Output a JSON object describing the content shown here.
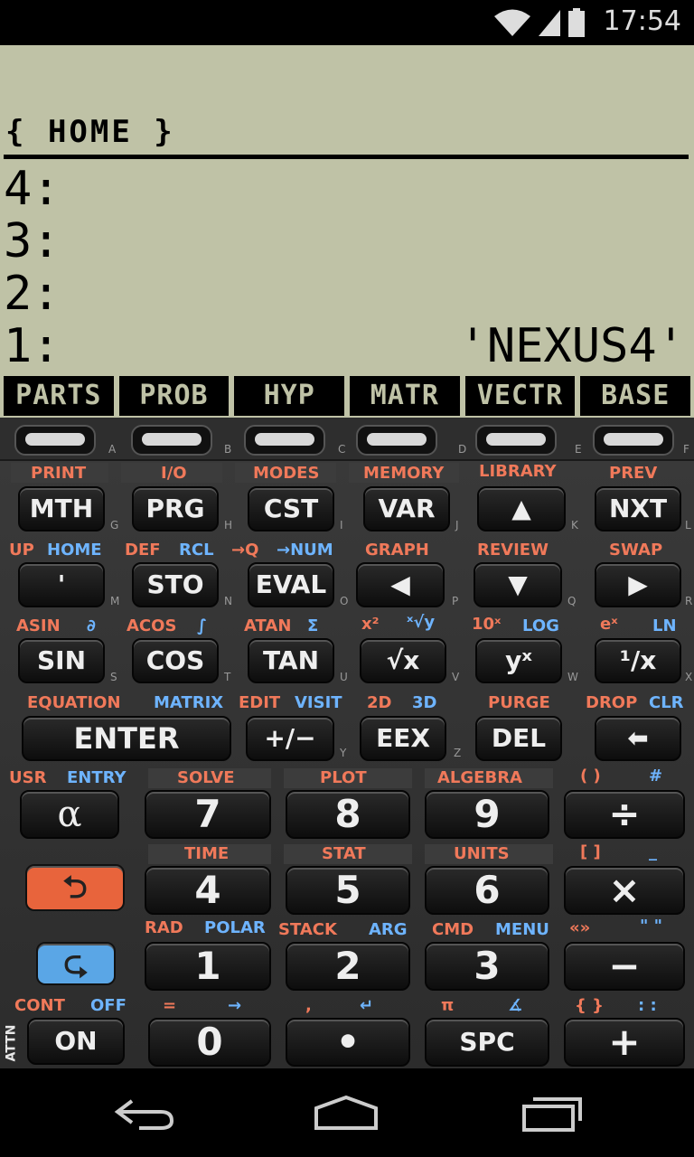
{
  "status_bar": {
    "time": "17:54",
    "icons": [
      "wifi-icon",
      "cell-signal-icon",
      "battery-icon"
    ]
  },
  "lcd": {
    "directory": "{ HOME }",
    "stack": [
      {
        "level": "4:",
        "value": ""
      },
      {
        "level": "3:",
        "value": ""
      },
      {
        "level": "2:",
        "value": ""
      },
      {
        "level": "1:",
        "value": "'NEXUS4'"
      }
    ],
    "menu_keys": [
      "PARTS",
      "PROB",
      "HYP",
      "MATR",
      "VECTR",
      "BASE"
    ]
  },
  "soft_key_letters": [
    "A",
    "B",
    "C",
    "D",
    "E",
    "F"
  ],
  "rows": {
    "r1": {
      "shift": [
        "PRINT",
        "I/O",
        "MODES",
        "MEMORY",
        "LIBRARY",
        "PREV"
      ],
      "keys": [
        "MTH",
        "PRG",
        "CST",
        "VAR",
        "▲",
        "NXT"
      ],
      "alpha": [
        "G",
        "H",
        "I",
        "J",
        "K",
        "L"
      ]
    },
    "r2": {
      "shift_left": [
        "UP",
        "DEF",
        "→Q",
        "GRAPH",
        "REVIEW",
        "SWAP"
      ],
      "shift_right": [
        "HOME",
        "RCL",
        "→NUM"
      ],
      "keys": [
        "'",
        "STO",
        "EVAL",
        "◀",
        "▼",
        "▶"
      ],
      "alpha": [
        "M",
        "N",
        "O",
        "P",
        "Q",
        "R"
      ]
    },
    "r3": {
      "shift_left": [
        "ASIN",
        "ACOS",
        "ATAN",
        "x²",
        "10ˣ",
        "eˣ"
      ],
      "shift_right": [
        "∂",
        "∫",
        "Σ",
        "ˣ√y",
        "LOG",
        "LN"
      ],
      "keys": [
        "SIN",
        "COS",
        "TAN",
        "√x",
        "yˣ",
        "¹/x"
      ],
      "alpha": [
        "S",
        "T",
        "U",
        "V",
        "W",
        "X"
      ]
    },
    "r4": {
      "shift_left": [
        "EQUATION",
        "EDIT",
        "2D",
        "PURGE",
        "DROP"
      ],
      "shift_right": [
        "MATRIX",
        "VISIT",
        "3D",
        "CLR"
      ],
      "keys": [
        "ENTER",
        "+/−",
        "EEX",
        "DEL",
        "⬅"
      ],
      "alpha": [
        "Y",
        "Z"
      ]
    },
    "r5": {
      "shift_left": [
        "USR",
        "SOLVE",
        "PLOT",
        "ALGEBRA",
        "( )"
      ],
      "shift_right": [
        "ENTRY",
        "#"
      ],
      "keys": [
        "α",
        "7",
        "8",
        "9",
        "÷"
      ]
    },
    "r6": {
      "shift_left": [
        "TIME",
        "STAT",
        "UNITS",
        "[ ]"
      ],
      "shift_right": [
        "_"
      ],
      "keys": [
        "⮌",
        "4",
        "5",
        "6",
        "×"
      ]
    },
    "r7": {
      "shift_left": [
        "RAD",
        "STACK",
        "CMD",
        "«»"
      ],
      "shift_right": [
        "POLAR",
        "ARG",
        "MENU",
        "\" \""
      ],
      "keys": [
        "⮎",
        "1",
        "2",
        "3",
        "−"
      ]
    },
    "r8": {
      "shift_left": [
        "CONT",
        "=",
        ",",
        "π",
        "{ }"
      ],
      "shift_right": [
        "OFF",
        "→",
        "↵",
        "∡",
        ": :"
      ],
      "keys": [
        "ON",
        "0",
        "•",
        "SPC",
        "+"
      ],
      "side": "ATTN"
    }
  },
  "colors": {
    "lcd_bg": "#bfc2a6",
    "shift_left": "#f0795a",
    "shift_right": "#6eb4ff",
    "left_shift_key": "#e8643c",
    "right_shift_key": "#5aa6e6"
  }
}
